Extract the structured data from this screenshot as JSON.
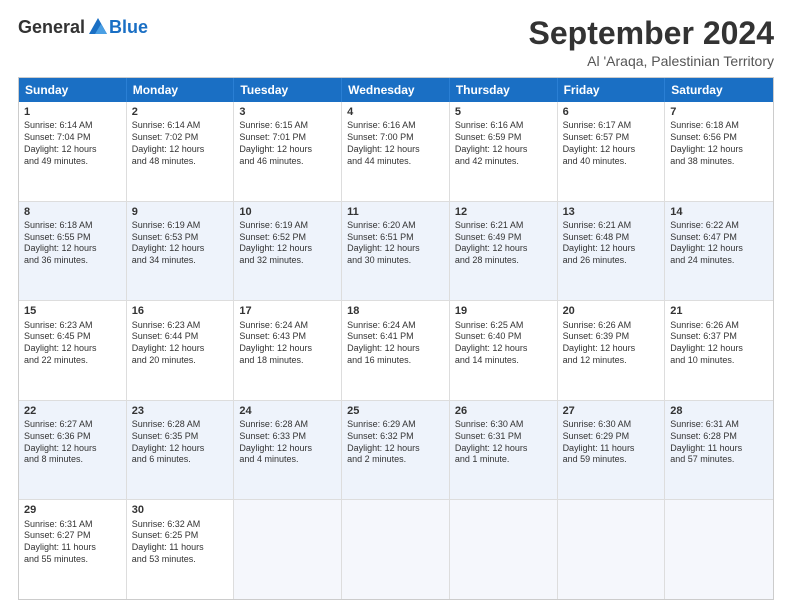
{
  "logo": {
    "general": "General",
    "blue": "Blue"
  },
  "title": "September 2024",
  "subtitle": "Al 'Araqa, Palestinian Territory",
  "headers": [
    "Sunday",
    "Monday",
    "Tuesday",
    "Wednesday",
    "Thursday",
    "Friday",
    "Saturday"
  ],
  "rows": [
    [
      {
        "day": "",
        "lines": []
      },
      {
        "day": "2",
        "lines": [
          "Sunrise: 6:14 AM",
          "Sunset: 7:02 PM",
          "Daylight: 12 hours",
          "and 48 minutes."
        ]
      },
      {
        "day": "3",
        "lines": [
          "Sunrise: 6:15 AM",
          "Sunset: 7:01 PM",
          "Daylight: 12 hours",
          "and 46 minutes."
        ]
      },
      {
        "day": "4",
        "lines": [
          "Sunrise: 6:16 AM",
          "Sunset: 7:00 PM",
          "Daylight: 12 hours",
          "and 44 minutes."
        ]
      },
      {
        "day": "5",
        "lines": [
          "Sunrise: 6:16 AM",
          "Sunset: 6:59 PM",
          "Daylight: 12 hours",
          "and 42 minutes."
        ]
      },
      {
        "day": "6",
        "lines": [
          "Sunrise: 6:17 AM",
          "Sunset: 6:57 PM",
          "Daylight: 12 hours",
          "and 40 minutes."
        ]
      },
      {
        "day": "7",
        "lines": [
          "Sunrise: 6:18 AM",
          "Sunset: 6:56 PM",
          "Daylight: 12 hours",
          "and 38 minutes."
        ]
      }
    ],
    [
      {
        "day": "8",
        "lines": [
          "Sunrise: 6:18 AM",
          "Sunset: 6:55 PM",
          "Daylight: 12 hours",
          "and 36 minutes."
        ]
      },
      {
        "day": "9",
        "lines": [
          "Sunrise: 6:19 AM",
          "Sunset: 6:53 PM",
          "Daylight: 12 hours",
          "and 34 minutes."
        ]
      },
      {
        "day": "10",
        "lines": [
          "Sunrise: 6:19 AM",
          "Sunset: 6:52 PM",
          "Daylight: 12 hours",
          "and 32 minutes."
        ]
      },
      {
        "day": "11",
        "lines": [
          "Sunrise: 6:20 AM",
          "Sunset: 6:51 PM",
          "Daylight: 12 hours",
          "and 30 minutes."
        ]
      },
      {
        "day": "12",
        "lines": [
          "Sunrise: 6:21 AM",
          "Sunset: 6:49 PM",
          "Daylight: 12 hours",
          "and 28 minutes."
        ]
      },
      {
        "day": "13",
        "lines": [
          "Sunrise: 6:21 AM",
          "Sunset: 6:48 PM",
          "Daylight: 12 hours",
          "and 26 minutes."
        ]
      },
      {
        "day": "14",
        "lines": [
          "Sunrise: 6:22 AM",
          "Sunset: 6:47 PM",
          "Daylight: 12 hours",
          "and 24 minutes."
        ]
      }
    ],
    [
      {
        "day": "15",
        "lines": [
          "Sunrise: 6:23 AM",
          "Sunset: 6:45 PM",
          "Daylight: 12 hours",
          "and 22 minutes."
        ]
      },
      {
        "day": "16",
        "lines": [
          "Sunrise: 6:23 AM",
          "Sunset: 6:44 PM",
          "Daylight: 12 hours",
          "and 20 minutes."
        ]
      },
      {
        "day": "17",
        "lines": [
          "Sunrise: 6:24 AM",
          "Sunset: 6:43 PM",
          "Daylight: 12 hours",
          "and 18 minutes."
        ]
      },
      {
        "day": "18",
        "lines": [
          "Sunrise: 6:24 AM",
          "Sunset: 6:41 PM",
          "Daylight: 12 hours",
          "and 16 minutes."
        ]
      },
      {
        "day": "19",
        "lines": [
          "Sunrise: 6:25 AM",
          "Sunset: 6:40 PM",
          "Daylight: 12 hours",
          "and 14 minutes."
        ]
      },
      {
        "day": "20",
        "lines": [
          "Sunrise: 6:26 AM",
          "Sunset: 6:39 PM",
          "Daylight: 12 hours",
          "and 12 minutes."
        ]
      },
      {
        "day": "21",
        "lines": [
          "Sunrise: 6:26 AM",
          "Sunset: 6:37 PM",
          "Daylight: 12 hours",
          "and 10 minutes."
        ]
      }
    ],
    [
      {
        "day": "22",
        "lines": [
          "Sunrise: 6:27 AM",
          "Sunset: 6:36 PM",
          "Daylight: 12 hours",
          "and 8 minutes."
        ]
      },
      {
        "day": "23",
        "lines": [
          "Sunrise: 6:28 AM",
          "Sunset: 6:35 PM",
          "Daylight: 12 hours",
          "and 6 minutes."
        ]
      },
      {
        "day": "24",
        "lines": [
          "Sunrise: 6:28 AM",
          "Sunset: 6:33 PM",
          "Daylight: 12 hours",
          "and 4 minutes."
        ]
      },
      {
        "day": "25",
        "lines": [
          "Sunrise: 6:29 AM",
          "Sunset: 6:32 PM",
          "Daylight: 12 hours",
          "and 2 minutes."
        ]
      },
      {
        "day": "26",
        "lines": [
          "Sunrise: 6:30 AM",
          "Sunset: 6:31 PM",
          "Daylight: 12 hours",
          "and 1 minute."
        ]
      },
      {
        "day": "27",
        "lines": [
          "Sunrise: 6:30 AM",
          "Sunset: 6:29 PM",
          "Daylight: 11 hours",
          "and 59 minutes."
        ]
      },
      {
        "day": "28",
        "lines": [
          "Sunrise: 6:31 AM",
          "Sunset: 6:28 PM",
          "Daylight: 11 hours",
          "and 57 minutes."
        ]
      }
    ],
    [
      {
        "day": "29",
        "lines": [
          "Sunrise: 6:31 AM",
          "Sunset: 6:27 PM",
          "Daylight: 11 hours",
          "and 55 minutes."
        ]
      },
      {
        "day": "30",
        "lines": [
          "Sunrise: 6:32 AM",
          "Sunset: 6:25 PM",
          "Daylight: 11 hours",
          "and 53 minutes."
        ]
      },
      {
        "day": "",
        "lines": []
      },
      {
        "day": "",
        "lines": []
      },
      {
        "day": "",
        "lines": []
      },
      {
        "day": "",
        "lines": []
      },
      {
        "day": "",
        "lines": []
      }
    ]
  ],
  "row1_special": {
    "day": "1",
    "lines": [
      "Sunrise: 6:14 AM",
      "Sunset: 7:04 PM",
      "Daylight: 12 hours",
      "and 49 minutes."
    ]
  }
}
